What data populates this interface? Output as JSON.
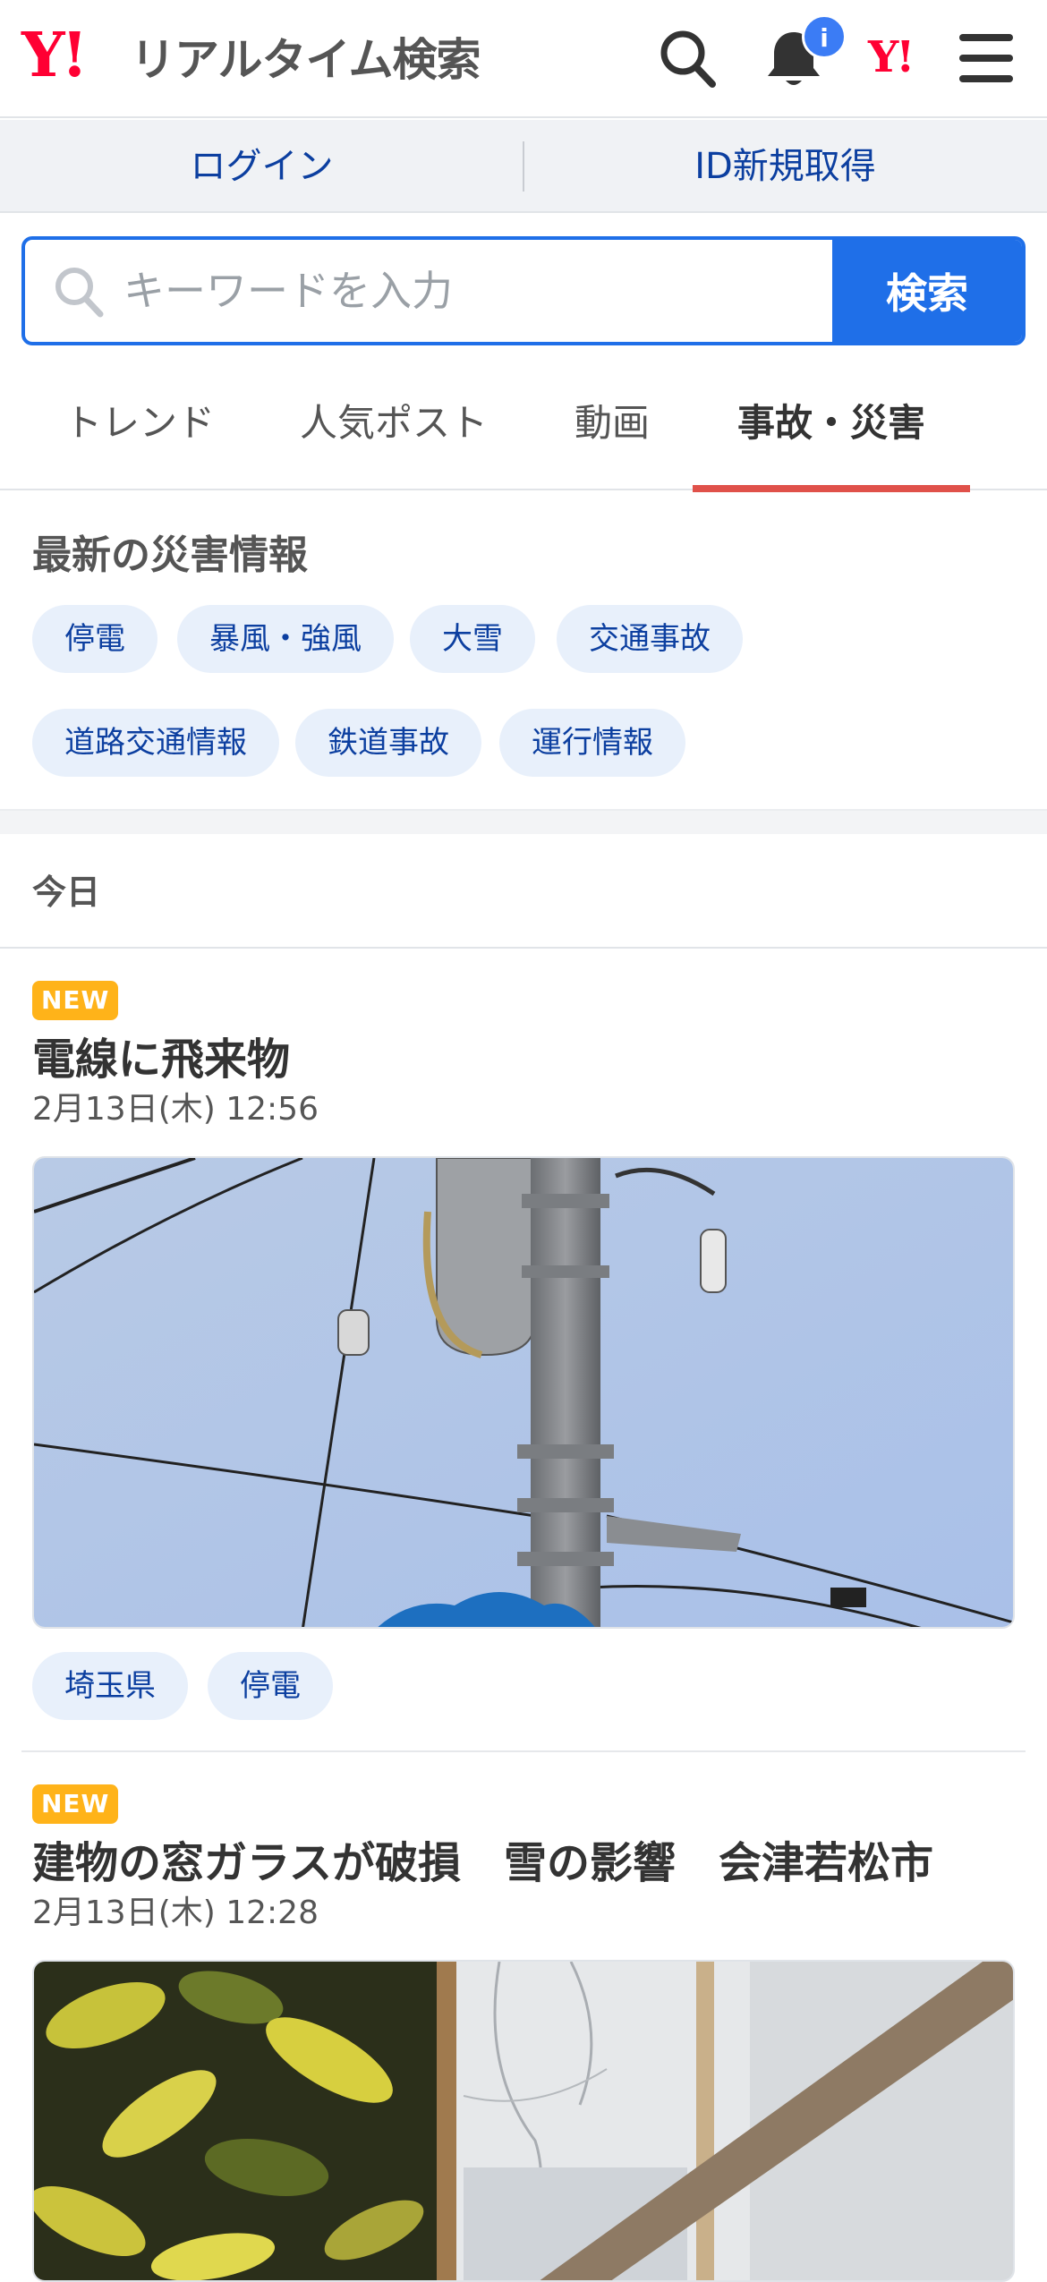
{
  "header": {
    "logo_mark": "Y!",
    "logo_text": "リアルタイム検索",
    "notification_badge": "i",
    "yahoo_mark": "Y!"
  },
  "account": {
    "login_label": "ログイン",
    "signup_label": "ID新規取得"
  },
  "search": {
    "placeholder": "キーワードを入力",
    "button_label": "検索"
  },
  "tabs": [
    {
      "label": "トレンド",
      "active": false
    },
    {
      "label": "人気ポスト",
      "active": false
    },
    {
      "label": "動画",
      "active": false
    },
    {
      "label": "事故・災害",
      "active": true
    }
  ],
  "disaster_section": {
    "title": "最新の災害情報",
    "chips": [
      "停電",
      "暴風・強風",
      "大雪",
      "交通事故",
      "道路交通情報",
      "鉄道事故",
      "運行情報"
    ]
  },
  "day_label": "今日",
  "articles": [
    {
      "badge": "NEW",
      "title": "電線に飛来物",
      "date": "2月13日(木) 12:56",
      "image": "utility-pole-photo",
      "tags": [
        "埼玉県",
        "停電"
      ]
    },
    {
      "badge": "NEW",
      "title": "建物の窓ガラスが破損　雪の影響　会津若松市",
      "date": "2月13日(木) 12:28",
      "image": "broken-window-photo",
      "tags": []
    }
  ],
  "colors": {
    "brand_red": "#ff0033",
    "accent_blue": "#1f6fe8",
    "link_blue": "#0c3fa0",
    "chip_bg": "#e8f0fb",
    "tab_underline": "#e0514a",
    "new_badge": "#ffb319"
  }
}
